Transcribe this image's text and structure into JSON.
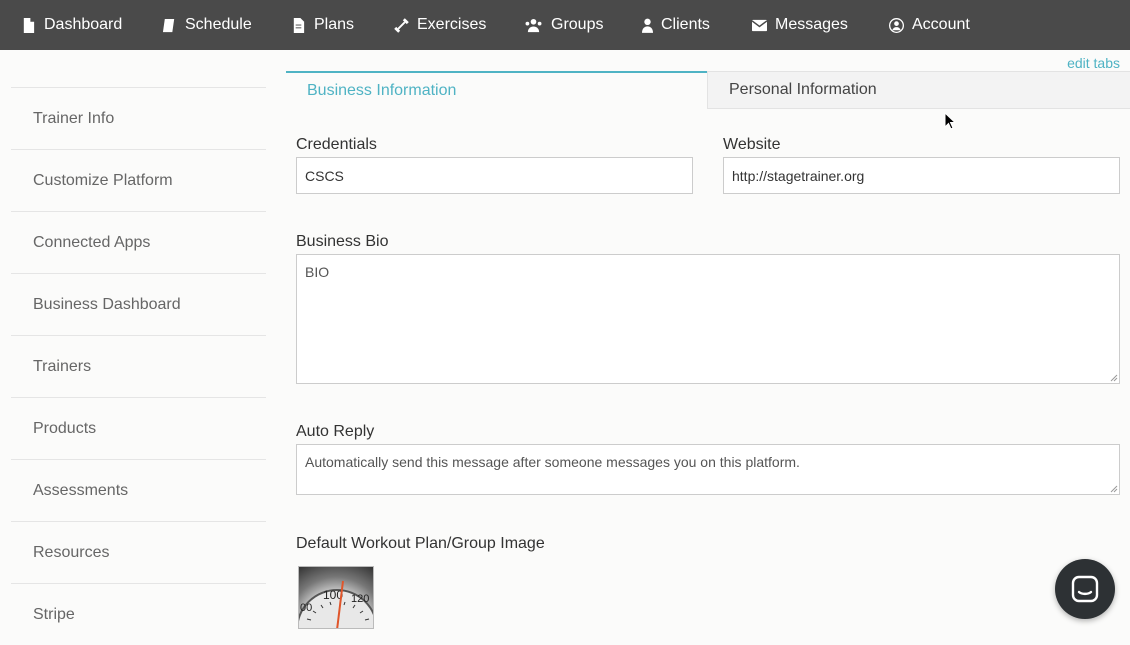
{
  "nav": {
    "items": [
      {
        "label": "Dashboard",
        "icon": "file-icon"
      },
      {
        "label": "Schedule",
        "icon": "book-icon"
      },
      {
        "label": "Plans",
        "icon": "file-text-icon"
      },
      {
        "label": "Exercises",
        "icon": "dumbbell-icon"
      },
      {
        "label": "Groups",
        "icon": "users-icon"
      },
      {
        "label": "Clients",
        "icon": "user-icon"
      },
      {
        "label": "Messages",
        "icon": "envelope-icon"
      },
      {
        "label": "Account",
        "icon": "user-circle-icon"
      }
    ]
  },
  "edit_tabs": "edit tabs",
  "sidebar": {
    "items": [
      {
        "label": "Trainer Info"
      },
      {
        "label": "Customize Platform"
      },
      {
        "label": "Connected Apps"
      },
      {
        "label": "Business Dashboard"
      },
      {
        "label": "Trainers"
      },
      {
        "label": "Products"
      },
      {
        "label": "Assessments"
      },
      {
        "label": "Resources"
      },
      {
        "label": "Stripe"
      }
    ]
  },
  "tabs": {
    "business": "Business Information",
    "personal": "Personal Information"
  },
  "form": {
    "credentials_label": "Credentials",
    "credentials_value": "CSCS",
    "website_label": "Website",
    "website_value": "http://stagetrainer.org",
    "bio_label": "Business Bio",
    "bio_value": "BIO",
    "auto_reply_label": "Auto Reply",
    "auto_reply_value": "Automatically send this message after someone messages you on this platform.",
    "default_image_label": "Default Workout Plan/Group Image"
  },
  "scale_image": {
    "numbers": [
      "00",
      "100",
      "120"
    ]
  },
  "colors": {
    "nav_bg": "#4a4a4a",
    "accent": "#4fb3c4",
    "chat_bg": "#2d3134"
  }
}
